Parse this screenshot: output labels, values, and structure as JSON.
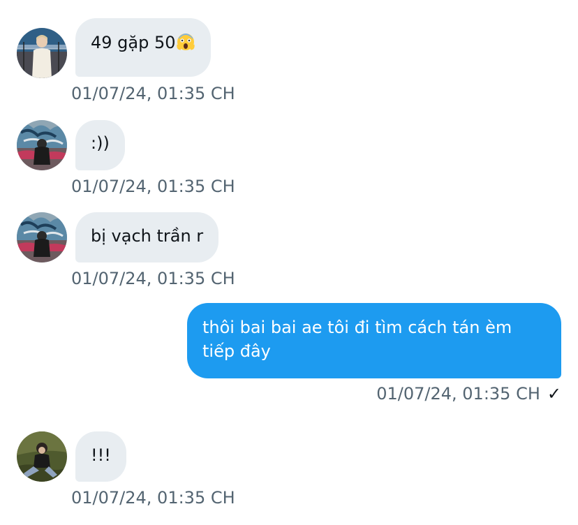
{
  "messages": [
    {
      "direction": "in",
      "avatar": "avatar-person-standing",
      "text": "49 gặp 50",
      "emoji": "screaming-face-icon",
      "timestamp": "01/07/24, 01:35 CH"
    },
    {
      "direction": "in",
      "avatar": "avatar-graffiti-wall",
      "text": ":))",
      "timestamp": "01/07/24, 01:35 CH"
    },
    {
      "direction": "in",
      "avatar": "avatar-graffiti-wall",
      "text": "bị vạch trần r",
      "timestamp": "01/07/24, 01:35 CH"
    },
    {
      "direction": "out",
      "text": "thôi bai bai ae tôi đi tìm cách tán èm tiếp đây",
      "timestamp": "01/07/24, 01:35 CH",
      "status_icon": "check-icon",
      "status_glyph": "✓"
    },
    {
      "direction": "in",
      "avatar": "avatar-person-sitting-grass",
      "text": "!!!",
      "timestamp": "01/07/24, 01:35 CH"
    }
  ],
  "colors": {
    "incoming_bubble": "#e8edf1",
    "outgoing_bubble": "#1d9bf0",
    "timestamp": "#536471"
  }
}
